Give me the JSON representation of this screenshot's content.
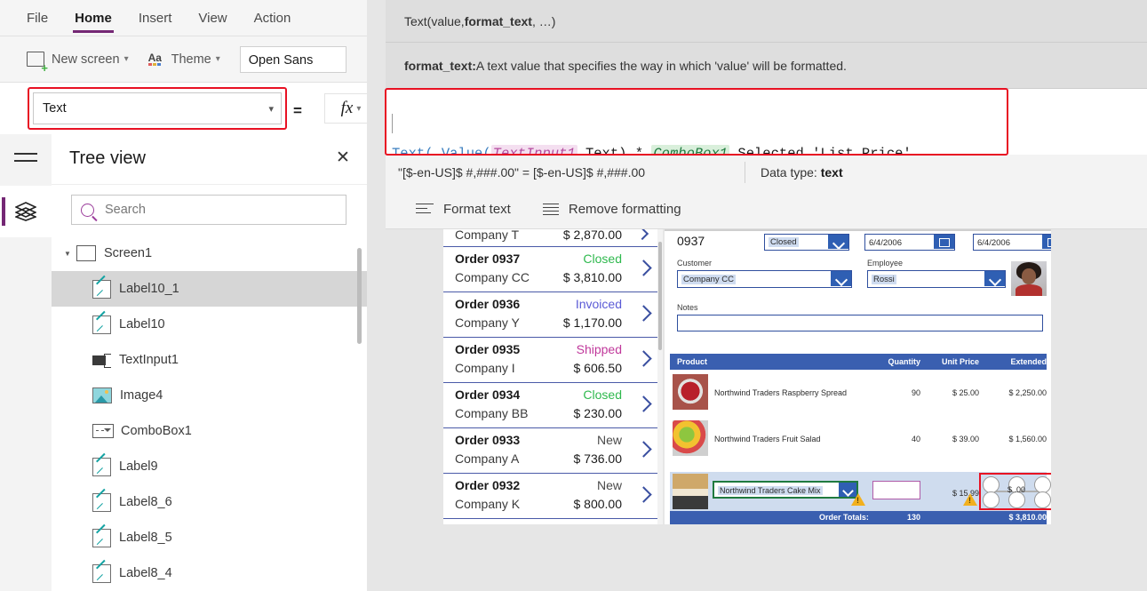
{
  "ribbon": {
    "tabs": [
      {
        "label": "File",
        "active": false
      },
      {
        "label": "Home",
        "active": true
      },
      {
        "label": "Insert",
        "active": false
      },
      {
        "label": "View",
        "active": false
      },
      {
        "label": "Action",
        "active": false
      }
    ],
    "new_screen_label": "New screen",
    "theme_label": "Theme",
    "font_name": "Open Sans"
  },
  "property_bar": {
    "selected_property": "Text",
    "equals": "=",
    "fx_label": "fx",
    "highlight_color": "#e81123"
  },
  "intellisense": {
    "signature_plain_1": "Text(value, ",
    "signature_bold": "format_text",
    "signature_plain_2": ", …)",
    "description_label": "format_text:",
    "description_text": " A text value that specifies the way in which 'value' will be formatted."
  },
  "formula": {
    "line1": {
      "fn_text": "Text(",
      "space1": " ",
      "fn_value": "Value(",
      "ctl_textinput": "TextInput1",
      "prop_text": ".Text)",
      "op_mult": " * ",
      "ctl_combobox": "ComboBox1",
      "prop_selected": ".Selected.'List Price',"
    },
    "line2": {
      "indent": "      ",
      "format_string": "\"[$-en-US]$ #,###.00\"",
      "close": " )"
    }
  },
  "result_bar": {
    "expression": "\"[$-en-US]$ #,###.00\"  =  [$-en-US]$ #,###.00",
    "datatype_label": "Data type: ",
    "datatype_value": "text"
  },
  "format_bar": {
    "format_text_label": "Format text",
    "remove_formatting_label": "Remove formatting"
  },
  "tree_view": {
    "title": "Tree view",
    "close_label": "✕",
    "search_placeholder": "Search",
    "search_value": "",
    "root": {
      "label": "Screen1",
      "icon": "screen-icon",
      "expanded": true
    },
    "items": [
      {
        "label": "Label10_1",
        "icon": "label-icon",
        "selected": true
      },
      {
        "label": "Label10",
        "icon": "label-icon",
        "selected": false
      },
      {
        "label": "TextInput1",
        "icon": "textinput-icon",
        "selected": false
      },
      {
        "label": "Image4",
        "icon": "image-icon",
        "selected": false
      },
      {
        "label": "ComboBox1",
        "icon": "combobox-icon",
        "selected": false
      },
      {
        "label": "Label9",
        "icon": "label-icon",
        "selected": false
      },
      {
        "label": "Label8_6",
        "icon": "label-icon",
        "selected": false
      },
      {
        "label": "Label8_5",
        "icon": "label-icon",
        "selected": false
      },
      {
        "label": "Label8_4",
        "icon": "label-icon",
        "selected": false
      }
    ]
  },
  "canvas": {
    "gallery": {
      "partial_row": {
        "company": "Company T",
        "amount": "$ 2,870.00"
      },
      "rows": [
        {
          "order": "Order 0937",
          "company": "Company CC",
          "status": "Closed",
          "status_class": "st-closed",
          "amount": "$ 3,810.00"
        },
        {
          "order": "Order 0936",
          "company": "Company Y",
          "status": "Invoiced",
          "status_class": "st-invoiced",
          "amount": "$ 1,170.00"
        },
        {
          "order": "Order 0935",
          "company": "Company I",
          "status": "Shipped",
          "status_class": "st-shipped",
          "amount": "$ 606.50"
        },
        {
          "order": "Order 0934",
          "company": "Company BB",
          "status": "Closed",
          "status_class": "st-closed",
          "amount": "$ 230.00"
        },
        {
          "order": "Order 0933",
          "company": "Company A",
          "status": "New",
          "status_class": "st-new",
          "amount": "$ 736.00"
        },
        {
          "order": "Order 0932",
          "company": "Company K",
          "status": "New",
          "status_class": "st-new",
          "amount": "$ 800.00"
        }
      ]
    },
    "detail": {
      "order_number": "0937",
      "status_value": "Closed",
      "order_date": "6/4/2006",
      "ship_date": "6/4/2006",
      "customer_label": "Customer",
      "customer_value": "Company CC",
      "employee_label": "Employee",
      "employee_value": "Rossi",
      "notes_label": "Notes",
      "notes_value": "",
      "columns": [
        "Product",
        "Quantity",
        "Unit Price",
        "Extended"
      ],
      "line_items": [
        {
          "product": "Northwind Traders Raspberry Spread",
          "quantity": "90",
          "unit_price": "$ 25.00",
          "extended": "$ 2,250.00",
          "img": "img-jam"
        },
        {
          "product": "Northwind Traders Fruit Salad",
          "quantity": "40",
          "unit_price": "$ 39.00",
          "extended": "$ 1,560.00",
          "img": "img-salad"
        }
      ],
      "edit_row": {
        "product": "Northwind Traders Cake Mix",
        "quantity": "",
        "unit_price": "$ 15.99",
        "extended": "$ .00",
        "img": "img-cake"
      },
      "totals": {
        "label": "Order Totals:",
        "quantity": "130",
        "amount": "$ 3,810.00"
      }
    }
  }
}
